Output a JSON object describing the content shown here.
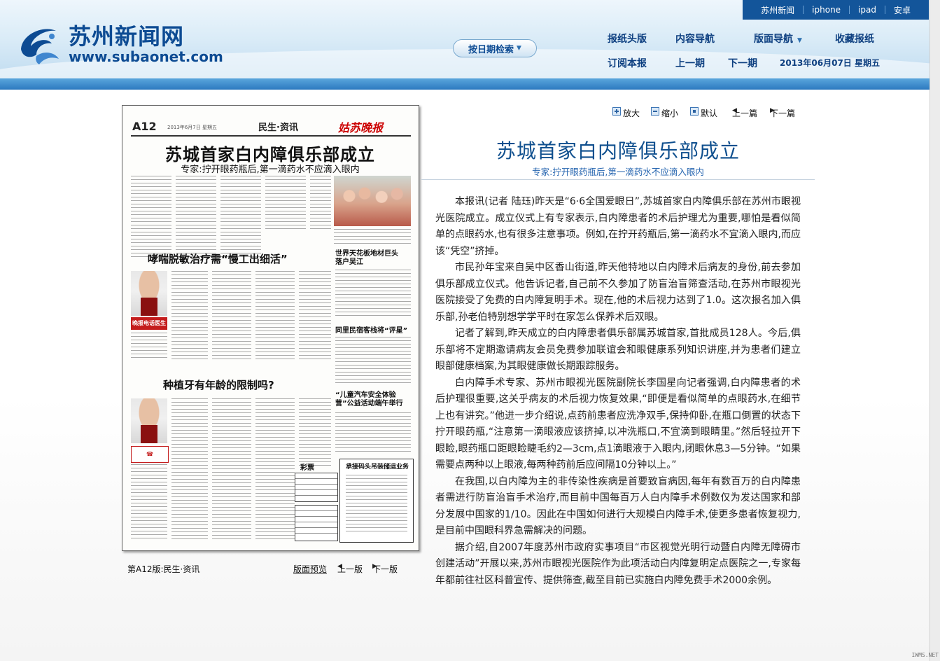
{
  "header": {
    "logo_cn": "苏州新闻网",
    "logo_en": "www.subaonet.com",
    "top_links": [
      "苏州新闻",
      "iphone",
      "ipad",
      "安卓"
    ],
    "search_label": "按日期检索",
    "nav_row1": [
      "报纸头版",
      "内容导航",
      "版面导航",
      "收藏报纸"
    ],
    "nav_row2": [
      "订阅本报",
      "上一期",
      "下一期"
    ],
    "date": "2013年06月07日 星期五"
  },
  "paper": {
    "page_no": "A12",
    "page_date": "2013年6月7日  星期五",
    "section": "民生·资讯",
    "brand": "姑苏晚报",
    "headline": "苏城首家白内障俱乐部成立",
    "subhead": "专家:拧开眼药瓶后,第一滴药水不应滴入眼内",
    "story2": "哮喘脱敏治疗需“慢工出细活”",
    "story3": "种植牙有年龄的限制吗?",
    "story4": "世界天花板地材巨头落户吴江",
    "story5": "同里民宿客栈将“评星”",
    "story6": "“儿童汽车安全体验营”公益活动端午举行",
    "ad_title": "承接码头吊装储运业务",
    "box_title": "彩票",
    "hotline": "晚报电话医生"
  },
  "pagebar": {
    "page_label": "第A12版:民生·资讯",
    "preview": "版面预览",
    "prev": "上一版",
    "next": "下一版"
  },
  "tools": {
    "zoom_in": "放大",
    "zoom_out": "缩小",
    "default": "默认",
    "prev_article": "上一篇",
    "next_article": "下一篇"
  },
  "article": {
    "title": "苏城首家白内障俱乐部成立",
    "subtitle": "专家:拧开眼药瓶后,第一滴药水不应滴入眼内",
    "paragraphs": [
      "本报讯(记者  陆珏)昨天是“6·6全国爱眼日”,苏城首家白内障俱乐部在苏州市眼视光医院成立。成立仪式上有专家表示,白内障患者的术后护理尤为重要,哪怕是看似简单的点眼药水,也有很多注意事项。例如,在拧开药瓶后,第一滴药水不宜滴入眼内,而应该“凭空”挤掉。",
      "市民孙年宝来自吴中区香山街道,昨天他特地以白内障术后病友的身份,前去参加俱乐部成立仪式。他告诉记者,自己前不久参加了防盲治盲筛查活动,在苏州市眼视光医院接受了免费的白内障复明手术。现在,他的术后视力达到了1.0。这次报名加入俱乐部,孙老伯特别想学学平时在家怎么保养术后双眼。",
      "记者了解到,昨天成立的白内障患者俱乐部属苏城首家,首批成员128人。今后,俱乐部将不定期邀请病友会员免费参加联谊会和眼健康系列知识讲座,并为患者们建立眼部健康档案,为其眼健康做长期跟踪服务。",
      "白内障手术专家、苏州市眼视光医院副院长李国星向记者强调,白内障患者的术后护理很重要,这关乎病友的术后视力恢复效果,“即便是看似简单的点眼药水,在细节上也有讲究。”他进一步介绍说,点药前患者应洗净双手,保持仰卧,在瓶口倒置的状态下拧开眼药瓶,“注意第一滴眼液应该挤掉,以冲洗瓶口,不宜滴到眼睛里。”然后轻拉开下眼睑,眼药瓶口距眼睑睫毛约2—3cm,点1滴眼液于入眼内,闭眼休息3—5分钟。“如果需要点两种以上眼液,每两种药前后应间隔10分钟以上。”",
      "在我国,以白内障为主的非传染性疾病是首要致盲病因,每年有数百万的白内障患者需进行防盲治盲手术治疗,而目前中国每百万人白内障手术例数仅为发达国家和部分发展中国家的1/10。因此在中国如何进行大规模白内障手术,使更多患者恢复视力,是目前中国眼科界急需解决的问题。",
      "据介绍,自2007年度苏州市政府实事项目“市区视觉光明行动暨白内障无障碍市创建活动”开展以来,苏州市眼视光医院作为此项活动白内障复明定点医院之一,专家每年都前往社区科普宣传、提供筛查,截至目前已实施白内障免费手术2000余例。"
    ]
  },
  "watermark": "IWMS.NET",
  "colors": {
    "brand_blue": "#0d4b93",
    "title_blue": "#0f4f8e",
    "top_strip": "#13559a"
  }
}
